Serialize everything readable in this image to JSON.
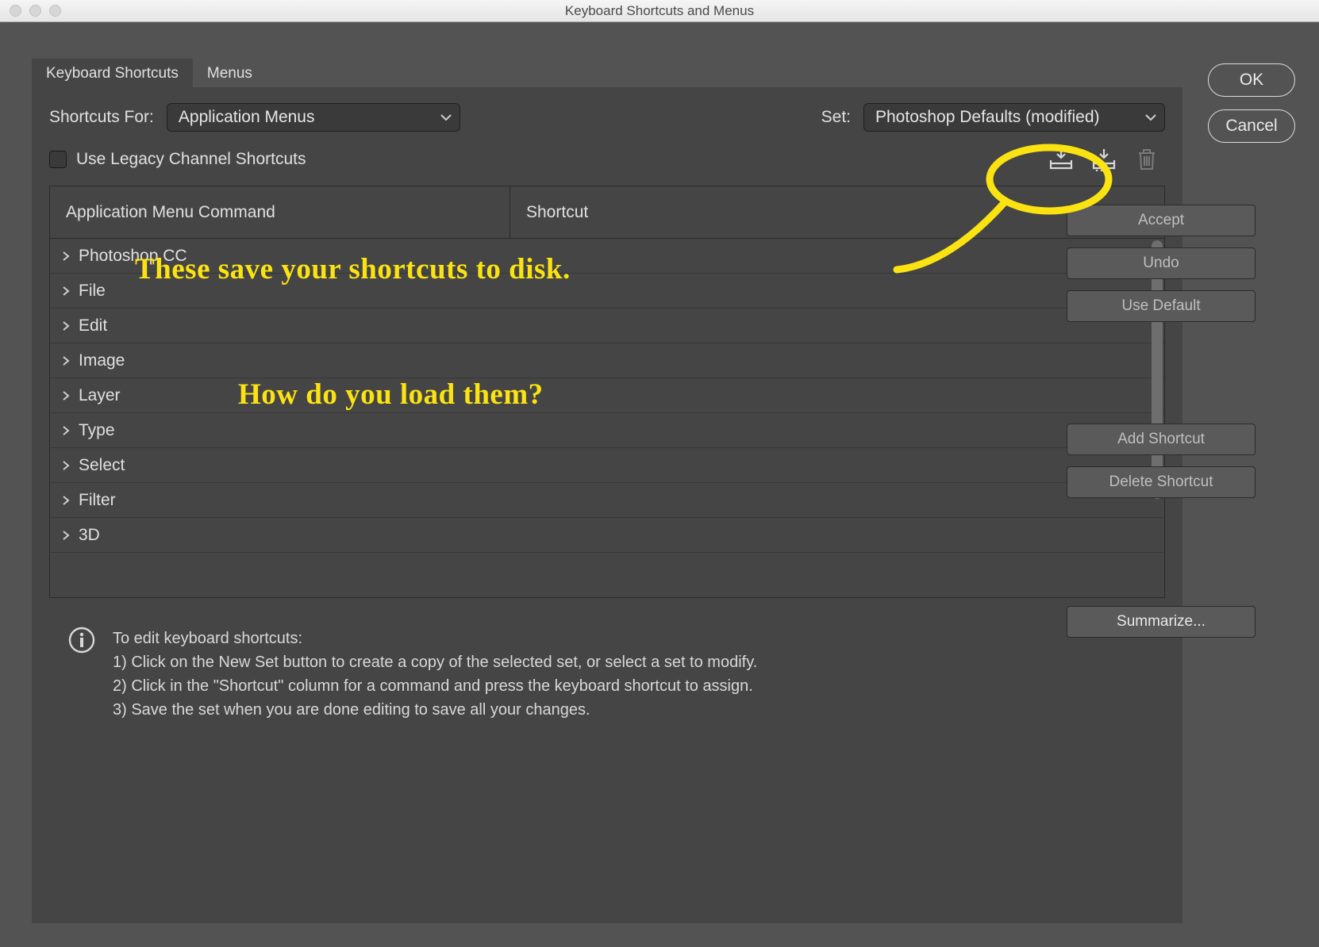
{
  "window": {
    "title": "Keyboard Shortcuts and Menus"
  },
  "tabs": {
    "shortcuts": "Keyboard Shortcuts",
    "menus": "Menus"
  },
  "shortcutsFor": {
    "label": "Shortcuts For:",
    "value": "Application Menus"
  },
  "set": {
    "label": "Set:",
    "value": "Photoshop Defaults (modified)"
  },
  "legacy": {
    "label": "Use Legacy Channel Shortcuts"
  },
  "columns": {
    "command": "Application Menu Command",
    "shortcut": "Shortcut"
  },
  "tree": [
    {
      "label": "Photoshop CC"
    },
    {
      "label": "File"
    },
    {
      "label": "Edit"
    },
    {
      "label": "Image"
    },
    {
      "label": "Layer"
    },
    {
      "label": "Type"
    },
    {
      "label": "Select"
    },
    {
      "label": "Filter"
    },
    {
      "label": "3D"
    }
  ],
  "actions": {
    "accept": "Accept",
    "undo": "Undo",
    "useDefault": "Use Default",
    "addShortcut": "Add Shortcut",
    "deleteShortcut": "Delete Shortcut",
    "summarize": "Summarize..."
  },
  "side": {
    "ok": "OK",
    "cancel": "Cancel"
  },
  "info": {
    "heading": "To edit keyboard shortcuts:",
    "l1": "1) Click on the New Set button to create a copy of the selected set, or select a set to modify.",
    "l2": "2) Click in the \"Shortcut\" column for a command and press the keyboard shortcut to assign.",
    "l3": "3) Save the set when you are done editing to save all your changes."
  },
  "annotations": {
    "line1": "These save your shortcuts to disk.",
    "line2": "How do you load them?"
  },
  "colors": {
    "highlight": "#fbe311"
  }
}
